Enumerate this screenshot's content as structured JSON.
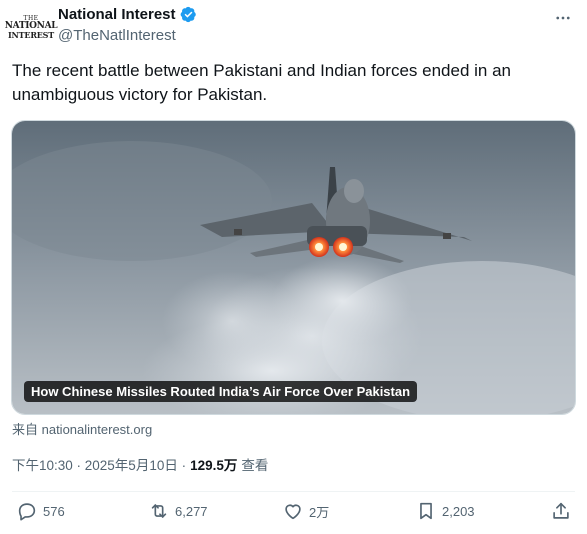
{
  "account": {
    "avatar_text": [
      "THE",
      "NATIONAL",
      "INTEREST"
    ],
    "name": "National Interest",
    "handle": "@TheNatlInterest",
    "verified": true
  },
  "tweet": {
    "text": "The recent battle between Pakistani and Indian forces ended in an unambiguous victory for Pakistan."
  },
  "media": {
    "caption": "How Chinese Missiles Routed India’s Air Force Over Pakistan"
  },
  "source": "来自 nationalinterest.org",
  "meta": {
    "timestamp": "下午10:30 · 2025年5月10日 ·",
    "views_count": "129.5万",
    "views_label": "查看"
  },
  "actions": {
    "replies": "576",
    "reposts": "6,277",
    "likes": "2万",
    "bookmarks": "2,203"
  },
  "colors": {
    "verified": "#1d9bf0",
    "secondary_text": "#536471",
    "primary_text": "#0f1419"
  },
  "icons": [
    "verified-badge-icon",
    "more-icon",
    "reply-icon",
    "repost-icon",
    "like-icon",
    "bookmark-icon",
    "share-icon"
  ]
}
